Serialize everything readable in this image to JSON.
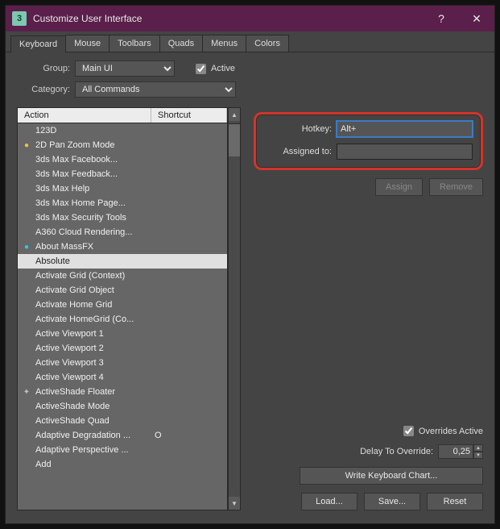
{
  "window": {
    "title": "Customize User Interface",
    "app_icon_char": "3"
  },
  "tabs": [
    "Keyboard",
    "Mouse",
    "Toolbars",
    "Quads",
    "Menus",
    "Colors"
  ],
  "active_tab": 0,
  "group": {
    "label": "Group:",
    "value": "Main UI",
    "active_label": "Active",
    "active_checked": true
  },
  "category": {
    "label": "Category:",
    "value": "All Commands"
  },
  "list": {
    "columns": {
      "action": "Action",
      "shortcut": "Shortcut"
    },
    "items": [
      {
        "label": "123D",
        "icon": ""
      },
      {
        "label": "2D Pan Zoom Mode",
        "icon": "●",
        "icon_color": "#f4c23c"
      },
      {
        "label": "3ds Max Facebook...",
        "icon": ""
      },
      {
        "label": "3ds Max Feedback...",
        "icon": ""
      },
      {
        "label": "3ds Max Help",
        "icon": ""
      },
      {
        "label": "3ds Max Home Page...",
        "icon": ""
      },
      {
        "label": "3ds Max Security Tools",
        "icon": ""
      },
      {
        "label": "A360 Cloud Rendering...",
        "icon": ""
      },
      {
        "label": "About MassFX",
        "icon": "●",
        "icon_color": "#35c7e8"
      },
      {
        "label": "Absolute",
        "icon": "",
        "selected": true
      },
      {
        "label": "Activate Grid (Context)",
        "icon": ""
      },
      {
        "label": "Activate Grid Object",
        "icon": ""
      },
      {
        "label": "Activate Home Grid",
        "icon": ""
      },
      {
        "label": "Activate HomeGrid (Co...",
        "icon": ""
      },
      {
        "label": "Active Viewport 1",
        "icon": ""
      },
      {
        "label": "Active Viewport 2",
        "icon": ""
      },
      {
        "label": "Active Viewport 3",
        "icon": ""
      },
      {
        "label": "Active Viewport 4",
        "icon": ""
      },
      {
        "label": "ActiveShade Floater",
        "icon": "✦",
        "icon_color": "#bfbfbf"
      },
      {
        "label": "ActiveShade Mode",
        "icon": ""
      },
      {
        "label": "ActiveShade Quad",
        "icon": ""
      },
      {
        "label": "Adaptive Degradation ...",
        "icon": "",
        "shortcut": "O"
      },
      {
        "label": "Adaptive Perspective ...",
        "icon": ""
      },
      {
        "label": "Add",
        "icon": ""
      }
    ]
  },
  "hotkey": {
    "label": "Hotkey:",
    "value": "Alt+"
  },
  "assigned": {
    "label": "Assigned to:",
    "value": ""
  },
  "assign_btn": "Assign",
  "remove_btn": "Remove",
  "overrides": {
    "label": "Overrides Active",
    "checked": true
  },
  "delay": {
    "label": "Delay To Override:",
    "value": "0,25"
  },
  "write_chart": "Write Keyboard Chart...",
  "footer": {
    "load": "Load...",
    "save": "Save...",
    "reset": "Reset"
  }
}
